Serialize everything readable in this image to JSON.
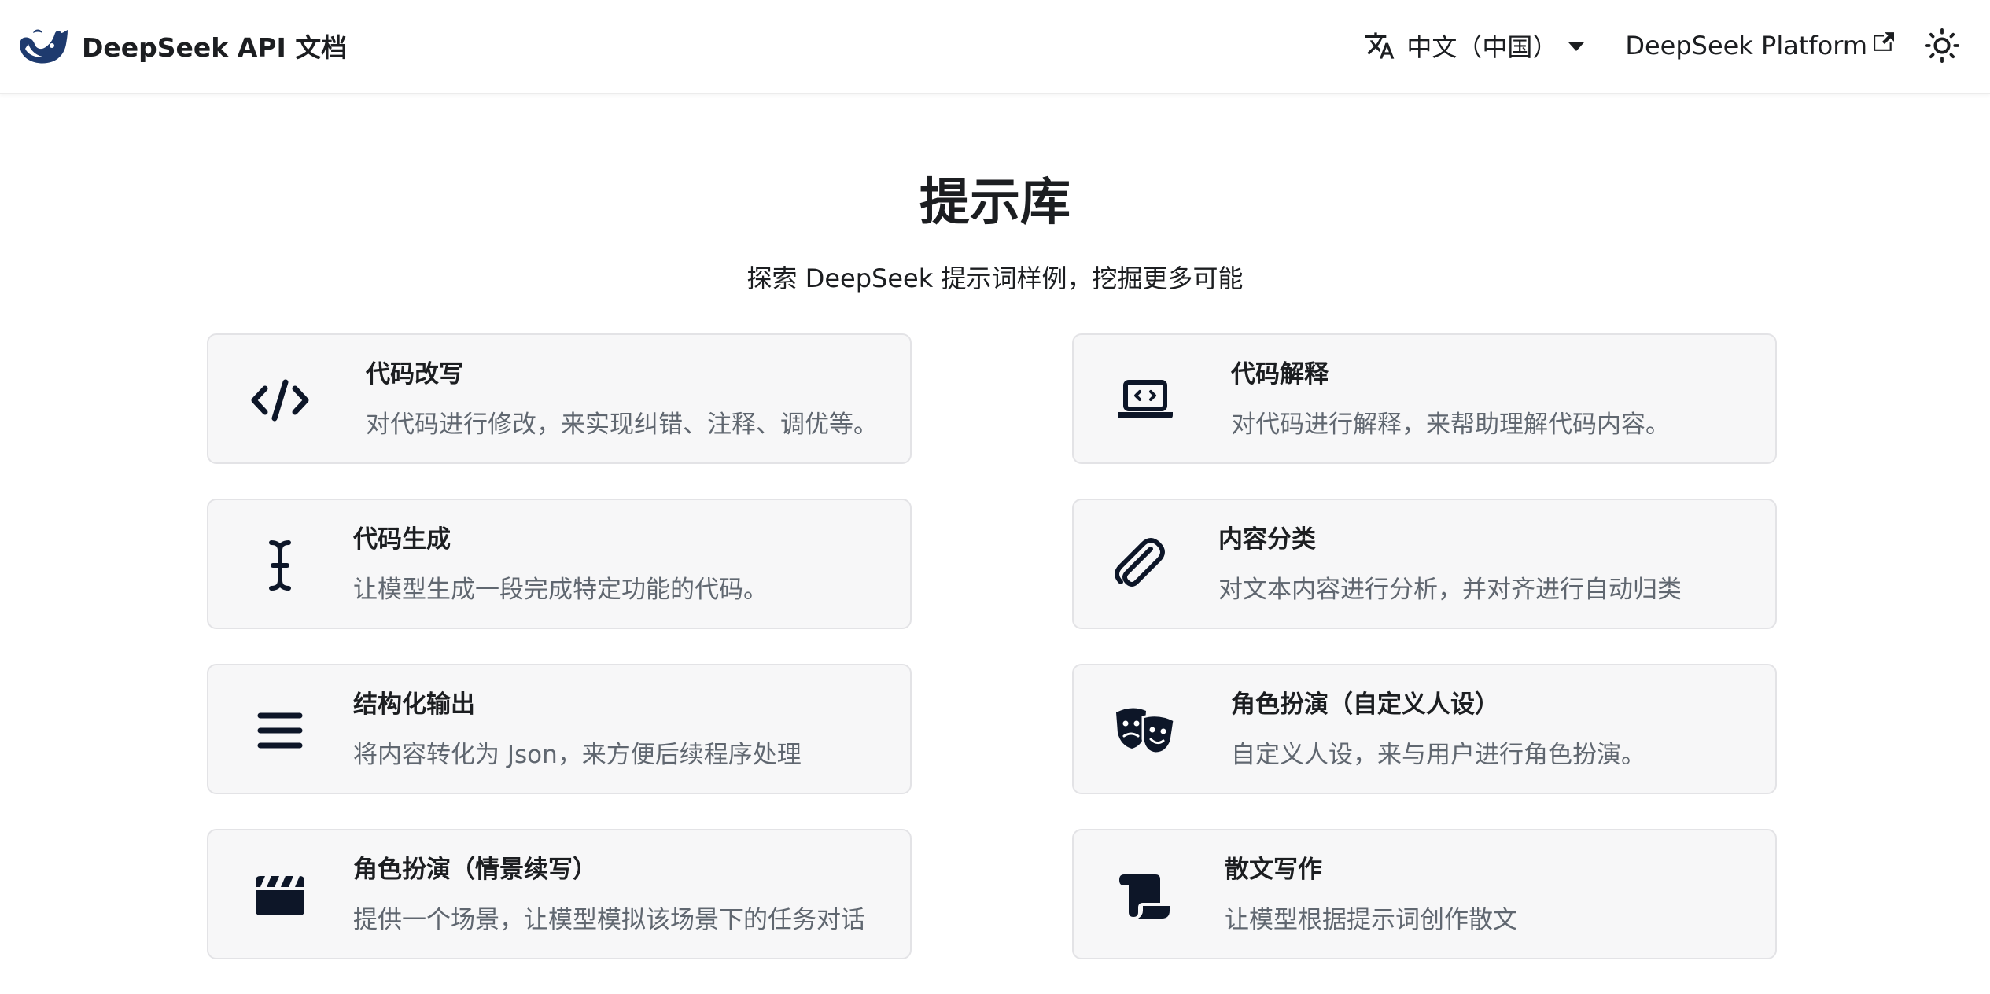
{
  "navbar": {
    "brand_title": "DeepSeek API 文档",
    "logo_icon": "deepseek-whale-logo",
    "locale_label": "中文（中国）",
    "locale_icon": "translate-icon",
    "platform_label": "DeepSeek Platform",
    "platform_icon": "external-link-icon",
    "theme_icon": "sun-icon"
  },
  "page": {
    "title": "提示库",
    "subtitle": "探索 DeepSeek 提示词样例，挖掘更多可能"
  },
  "cards": [
    {
      "title": "代码改写",
      "description": "对代码进行修改，来实现纠错、注释、调优等。",
      "icon": "code-icon"
    },
    {
      "title": "代码解释",
      "description": "对代码进行解释，来帮助理解代码内容。",
      "icon": "laptop-code-icon"
    },
    {
      "title": "代码生成",
      "description": "让模型生成一段完成特定功能的代码。",
      "icon": "text-cursor-icon"
    },
    {
      "title": "内容分类",
      "description": "对文本内容进行分析，并对齐进行自动归类",
      "icon": "paperclip-icon"
    },
    {
      "title": "结构化输出",
      "description": "将内容转化为 Json，来方便后续程序处理",
      "icon": "bars-icon"
    },
    {
      "title": "角色扮演（自定义人设）",
      "description": "自定义人设，来与用户进行角色扮演。",
      "icon": "masks-theater-icon"
    },
    {
      "title": "角色扮演（情景续写）",
      "description": "提供一个场景，让模型模拟该场景下的任务对话",
      "icon": "clapperboard-icon"
    },
    {
      "title": "散文写作",
      "description": "让模型根据提示词创作散文",
      "icon": "scroll-icon"
    }
  ],
  "colors": {
    "text_primary": "#1c1e21",
    "text_secondary": "#606770",
    "card_bg": "#f7f7f8",
    "card_border": "#e3e3e6",
    "icon_color": "#0d1628"
  }
}
